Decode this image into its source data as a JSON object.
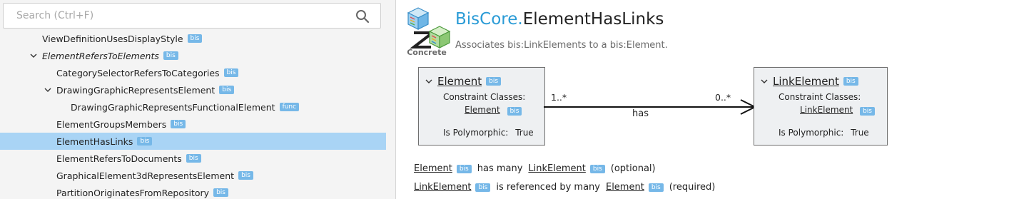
{
  "search": {
    "placeholder": "Search (Ctrl+F)",
    "icon": "search-icon"
  },
  "tree": {
    "items": [
      {
        "label": "ViewDefinitionUsesDisplayStyle",
        "badge": "bis"
      },
      {
        "label": "ElementRefersToElements",
        "badge": "bis",
        "expanded": true,
        "italic": true
      },
      {
        "label": "CategorySelectorRefersToCategories",
        "badge": "bis"
      },
      {
        "label": "DrawingGraphicRepresentsElement",
        "badge": "bis",
        "expanded": true
      },
      {
        "label": "DrawingGraphicRepresentsFunctionalElement",
        "badge": "func"
      },
      {
        "label": "ElementGroupsMembers",
        "badge": "bis"
      },
      {
        "label": "ElementHasLinks",
        "badge": "bis",
        "selected": true
      },
      {
        "label": "ElementRefersToDocuments",
        "badge": "bis"
      },
      {
        "label": "GraphicalElement3dRepresentsElement",
        "badge": "bis"
      },
      {
        "label": "PartitionOriginatesFromRepository",
        "badge": "bis"
      }
    ],
    "selected_color": "#a9d4f5"
  },
  "header": {
    "schema": "BisCore.",
    "class_name": "ElementHasLinks",
    "modifier": "Concrete",
    "description": "Associates bis:LinkElements to a bis:Element.",
    "schema_color": "#2a9bd6"
  },
  "source": {
    "name": "Element",
    "badge": "bis",
    "constraint_label": "Constraint Classes:",
    "constraint_class": "Element",
    "constraint_badge": "bis",
    "polymorphic_label": "Is Polymorphic:",
    "polymorphic_value": "True",
    "multiplicity": "1..*"
  },
  "target": {
    "name": "LinkElement",
    "badge": "bis",
    "constraint_label": "Constraint Classes:",
    "constraint_class": "LinkElement",
    "constraint_badge": "bis",
    "polymorphic_label": "Is Polymorphic:",
    "polymorphic_value": "True",
    "multiplicity": "0..*"
  },
  "relationship": {
    "label": "has"
  },
  "sentences": [
    {
      "subject": "Element",
      "subject_badge": "bis",
      "verb": "has many",
      "object": "LinkElement",
      "object_badge": "bis",
      "note": "(optional)"
    },
    {
      "subject": "LinkElement",
      "subject_badge": "bis",
      "verb": "is referenced by many",
      "object": "Element",
      "object_badge": "bis",
      "note": "(required)"
    }
  ],
  "badge_color": "#76b8e8"
}
